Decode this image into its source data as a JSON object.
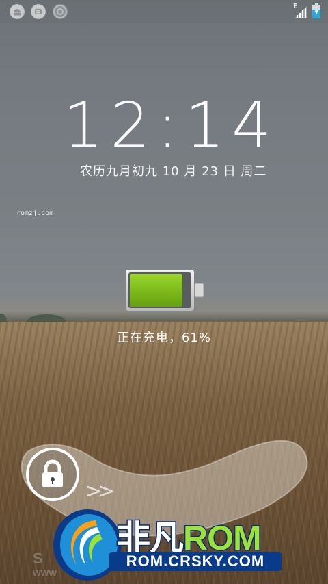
{
  "status_bar": {
    "left_icons": [
      "android-icon",
      "android-debug-icon",
      "sync-icon"
    ],
    "network_type": "E",
    "battery_level": 0.61,
    "charging": true
  },
  "lockscreen": {
    "time": "12:14",
    "date": "农历九月初九   10 月 23 日 周二",
    "watermark": "romzj.com",
    "charging_status": "正在充电，61%",
    "battery_level": 0.61,
    "battery_color": "#7dbb1a"
  },
  "unlock_slider": {
    "lock_icon": "lock-icon",
    "arrows": ">>"
  },
  "logo": {
    "cn_text": "非凡",
    "rom_text": "ROM",
    "url": "ROM.CRSKY.COM",
    "faint_text": "S",
    "faint_url": "www",
    "brand_blue": "#0a3a8a",
    "brand_green": "#9be23a"
  }
}
